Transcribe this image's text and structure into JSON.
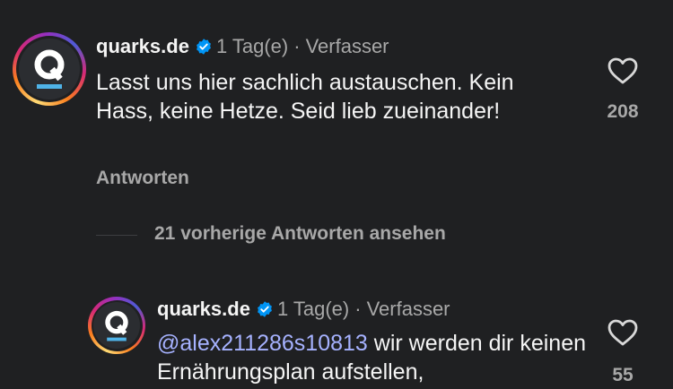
{
  "comment": {
    "username": "quarks.de",
    "time": "1 Tag(e)",
    "separator": "·",
    "role": "Verfasser",
    "text": "Lasst uns hier sachlich austauschen. Kein Hass, keine Hetze. Seid lieb zueinander!",
    "like_count": "208",
    "reply_label": "Antworten"
  },
  "view_more_replies": "21 vorherige Antworten ansehen",
  "reply": {
    "username": "quarks.de",
    "time": "1 Tag(e)",
    "separator": "·",
    "role": "Verfasser",
    "mention": "@alex211286s10813",
    "text": "wir werden dir keinen Ernährungsplan aufstellen,",
    "like_count": "55"
  },
  "icons": {
    "avatar_logo": "quarks-q-logo",
    "verified": "verified-badge-icon",
    "like": "heart-outline-icon"
  },
  "colors": {
    "background": "#1f2022",
    "verified_blue": "#0095f6",
    "mention": "#a6b2ff",
    "logo_accent": "#4fb3e8"
  }
}
